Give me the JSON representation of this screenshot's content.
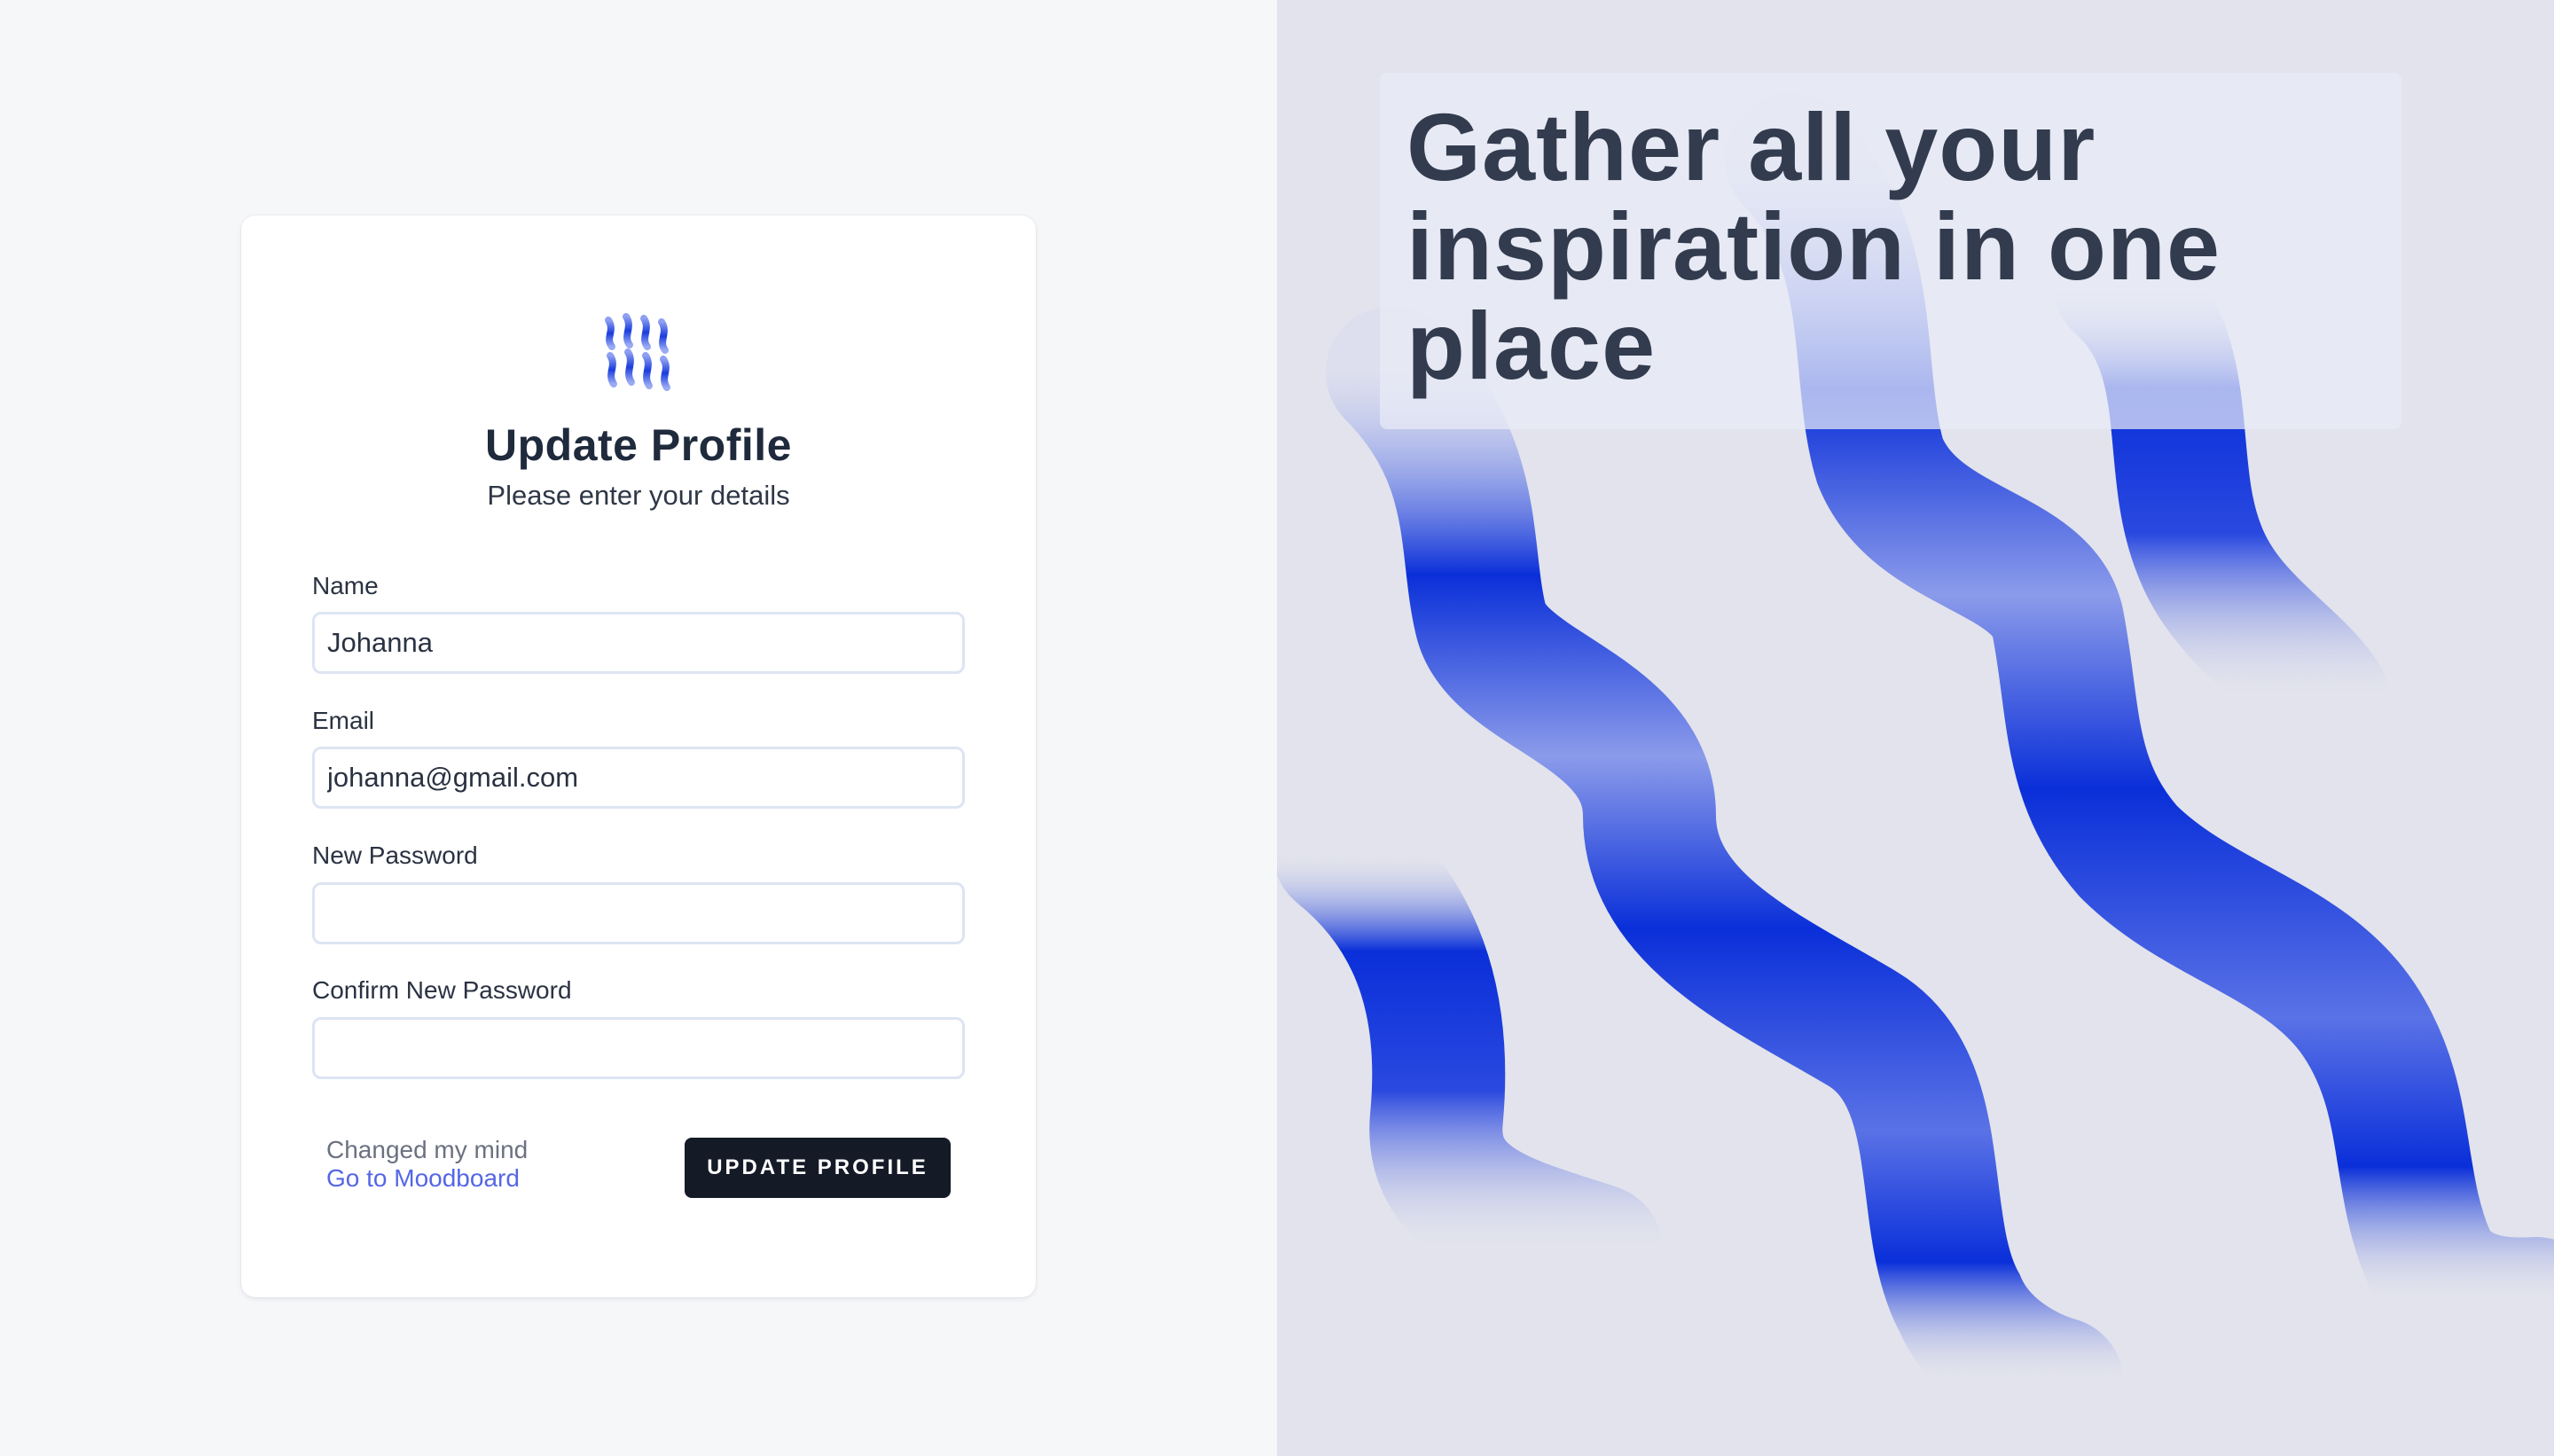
{
  "form": {
    "title": "Update Profile",
    "subtitle": "Please enter your details",
    "name_label": "Name",
    "name_value": "Johanna",
    "email_label": "Email",
    "email_value": "johanna@gmail.com",
    "new_password_label": "New Password",
    "new_password_value": "",
    "confirm_password_label": "Confirm New Password",
    "confirm_password_value": "",
    "changed_mind_text": "Changed my mind",
    "go_to_link": "Go to Moodboard",
    "submit_label": "UPDATE PROFILE"
  },
  "hero": {
    "tagline": "Gather all your inspiration in one place"
  },
  "icons": {
    "logo": "wavy-lines-logo"
  },
  "colors": {
    "accent_blue": "#0a2fd9",
    "link": "#5566e6",
    "button_bg": "#141a26",
    "panel_bg": "#e2e3ec"
  }
}
